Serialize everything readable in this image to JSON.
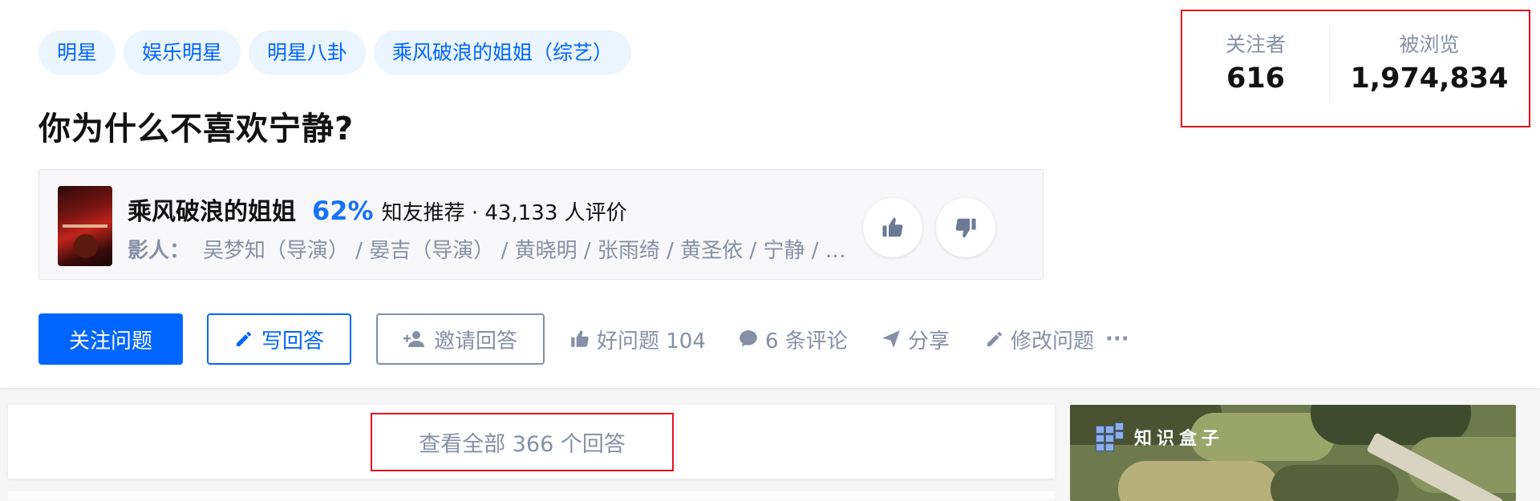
{
  "topics": [
    "明星",
    "娱乐明星",
    "明星八卦",
    "乘风破浪的姐姐（综艺）"
  ],
  "question": {
    "title": "你为什么不喜欢宁静?"
  },
  "card": {
    "name": "乘风破浪的姐姐",
    "percent": "62%",
    "recommend": "知友推荐 · 43,133 人评价",
    "cast_label": "影人：",
    "cast": "吴梦知（导演） / 晏吉（导演） / 黄晓明 / 张雨绮 / 黄圣依 / 宁静 / 万茜"
  },
  "stats": {
    "followers_label": "关注者",
    "followers_value": "616",
    "views_label": "被浏览",
    "views_value": "1,974,834"
  },
  "actions": {
    "follow": "关注问题",
    "write": "写回答",
    "invite": "邀请回答",
    "good": "好问题 104",
    "comments": "6 条评论",
    "share": "分享",
    "edit": "修改问题",
    "more": "···"
  },
  "answers": {
    "view_all": "查看全部 366 个回答"
  },
  "ad": {
    "brand": "知识盒子"
  },
  "colors": {
    "brand_blue": "#0066ff",
    "highlight_red": "#e0151f",
    "gray_text": "#8590a6"
  }
}
